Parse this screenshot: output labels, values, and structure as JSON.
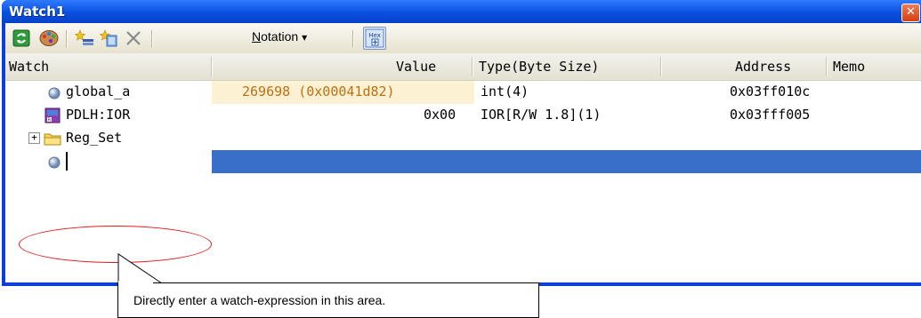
{
  "window": {
    "title": "Watch1"
  },
  "toolbar": {
    "notation_label_prefix": "N",
    "notation_label_rest": "otation",
    "notation_arrow": "▾",
    "hex_label": "Hex"
  },
  "columns": {
    "watch": "Watch",
    "value": "Value",
    "type": "Type(Byte Size)",
    "address": "Address",
    "memo": "Memo"
  },
  "rows": [
    {
      "watch": "global_a",
      "value": "269698 (0x00041d82)",
      "type": "int(4)",
      "address": "0x03ff010c",
      "icon": "variable-icon"
    },
    {
      "watch": "PDLH:IOR",
      "value": "0x00",
      "type": "IOR[R/W 1.8](1)",
      "address": "0x03fff005",
      "icon": "io-register-icon"
    },
    {
      "watch": "Reg_Set",
      "value": "",
      "type": "",
      "address": "",
      "icon": "folder-icon",
      "expander": "+"
    },
    {
      "watch": "",
      "value": "",
      "type": "",
      "address": "",
      "icon": "variable-icon",
      "editing": true
    }
  ],
  "annotation": {
    "callout": "Directly enter a watch-expression in this area."
  },
  "colors": {
    "title_bar": "#0a4fe0",
    "selection": "#3a6fc9",
    "value_highlight": "#fdf1d4",
    "value_text": "#bd6f12",
    "annotation_ellipse": "#e21b1b"
  }
}
